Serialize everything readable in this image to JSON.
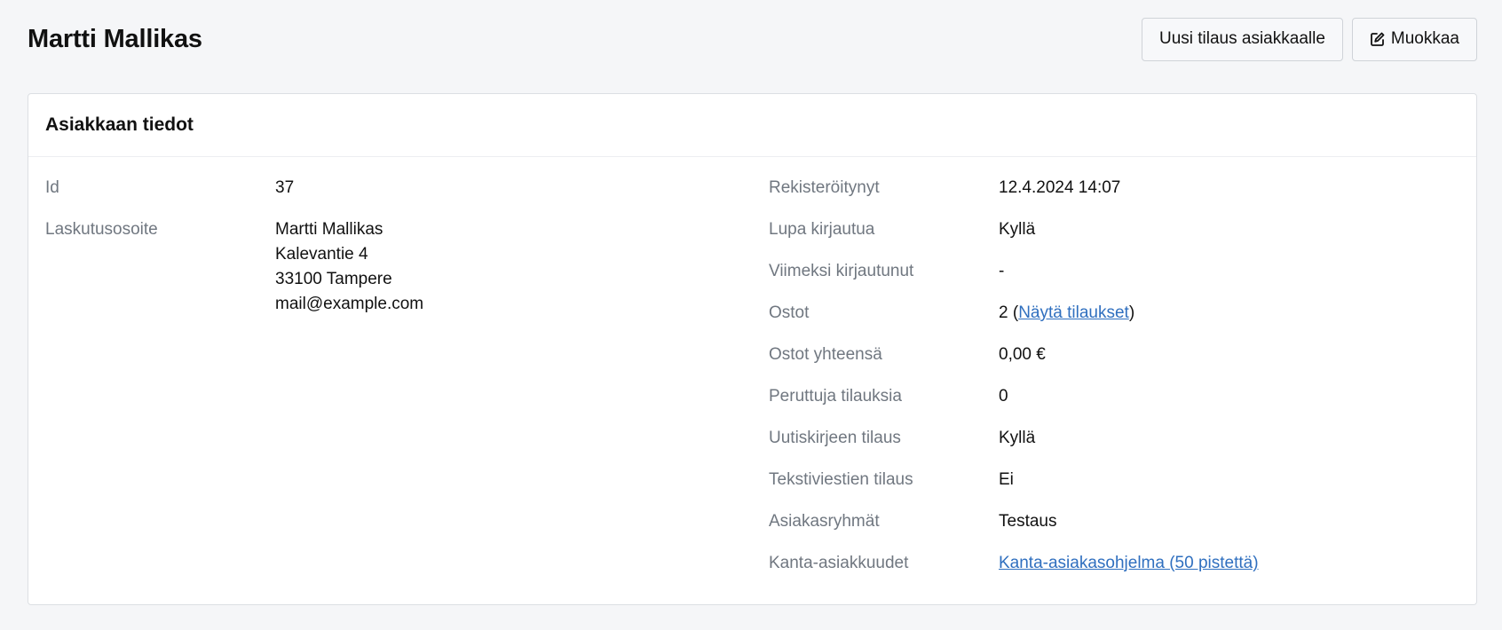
{
  "header": {
    "title": "Martti Mallikas",
    "new_order_label": "Uusi tilaus asiakkaalle",
    "edit_label": "Muokkaa"
  },
  "card": {
    "title": "Asiakkaan tiedot"
  },
  "left": {
    "id_label": "Id",
    "id_value": "37",
    "billing_label": "Laskutusosoite",
    "billing_lines": [
      "Martti Mallikas",
      "Kalevantie 4",
      "33100 Tampere",
      "mail@example.com"
    ]
  },
  "right": {
    "registered_label": "Rekisteröitynyt",
    "registered_value": "12.4.2024 14:07",
    "login_allowed_label": "Lupa kirjautua",
    "login_allowed_value": "Kyllä",
    "last_login_label": "Viimeksi kirjautunut",
    "last_login_value": "-",
    "purchases_label": "Ostot",
    "purchases_count": "2",
    "purchases_open": " (",
    "purchases_link": "Näytä tilaukset",
    "purchases_close": ")",
    "purchases_total_label": "Ostot yhteensä",
    "purchases_total_value": "0,00 €",
    "cancelled_label": "Peruttuja tilauksia",
    "cancelled_value": "0",
    "newsletter_label": "Uutiskirjeen tilaus",
    "newsletter_value": "Kyllä",
    "sms_label": "Tekstiviestien tilaus",
    "sms_value": "Ei",
    "groups_label": "Asiakasryhmät",
    "groups_value": "Testaus",
    "loyalty_label": "Kanta-asiakkuudet",
    "loyalty_link": "Kanta-asiakasohjelma (50 pistettä)"
  },
  "icons": {
    "edit": "edit-icon"
  },
  "colors": {
    "link": "#2f6fbf",
    "label": "#707780",
    "background": "#f5f6f8"
  }
}
